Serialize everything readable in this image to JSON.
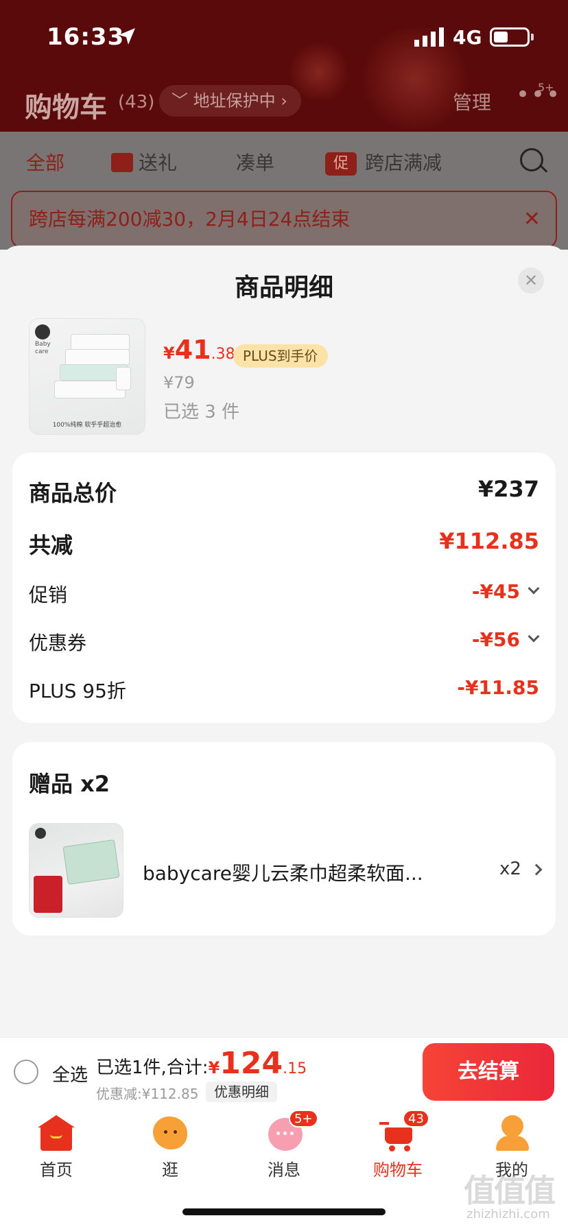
{
  "status_bar": {
    "time": "16:33",
    "network": "4G"
  },
  "background_page": {
    "title": "购物车",
    "count": "(43)",
    "address_protection": "地址保护中 ›",
    "manage": "管理",
    "more_badge": "5+",
    "tabs": [
      {
        "label": "全部"
      },
      {
        "label": "送礼"
      },
      {
        "label": "凑单"
      },
      {
        "label": "跨店满减",
        "tag": "促"
      }
    ],
    "promo_banner": "跨店每满200减30，2月4日24点结束"
  },
  "sheet": {
    "title": "商品明细",
    "product": {
      "price_yen": "¥",
      "price_int": "41",
      "price_dec": ".38",
      "plus_tag": "PLUS到手价",
      "original_price": "¥79",
      "selected": "已选 3 件",
      "image_brand": "Baby care",
      "image_caption": "100%纯棉 软乎乎超治愈"
    },
    "summary": {
      "total_label": "商品总价",
      "total_value": "¥237",
      "reduced_label": "共减",
      "reduced_value": "¥112.85",
      "items": [
        {
          "label": "促销",
          "value": "-¥45",
          "expandable": true
        },
        {
          "label": "优惠券",
          "value": "-¥56",
          "expandable": true
        },
        {
          "label": "PLUS 95折",
          "value": "-¥11.85",
          "expandable": false
        }
      ]
    },
    "gifts": {
      "title": "赠品 x2",
      "item_name": "babycare婴儿云柔巾超柔软面...",
      "item_qty": "x2"
    }
  },
  "checkout": {
    "select_all": "全选",
    "summary_label": "已选1件,合计:",
    "total_yen": "¥",
    "total_int": "124",
    "total_dec": ".15",
    "discount_line": "优惠减:¥112.85",
    "discount_detail": "优惠明细",
    "button": "去结算"
  },
  "tabbar": [
    {
      "label": "首页",
      "icon": "home-icon",
      "badge": ""
    },
    {
      "label": "逛",
      "icon": "browse-icon",
      "badge": ""
    },
    {
      "label": "消息",
      "icon": "message-icon",
      "badge": "5+"
    },
    {
      "label": "购物车",
      "icon": "cart-icon",
      "badge": "43",
      "active": true
    },
    {
      "label": "我的",
      "icon": "profile-icon",
      "badge": ""
    }
  ],
  "watermark": {
    "main": "值值值",
    "sub": "zhizhizhi.com"
  },
  "colors": {
    "accent": "#e8311d",
    "plus_tag_bg": "#fbe3a7",
    "header_bg": "#5a0a0a"
  }
}
